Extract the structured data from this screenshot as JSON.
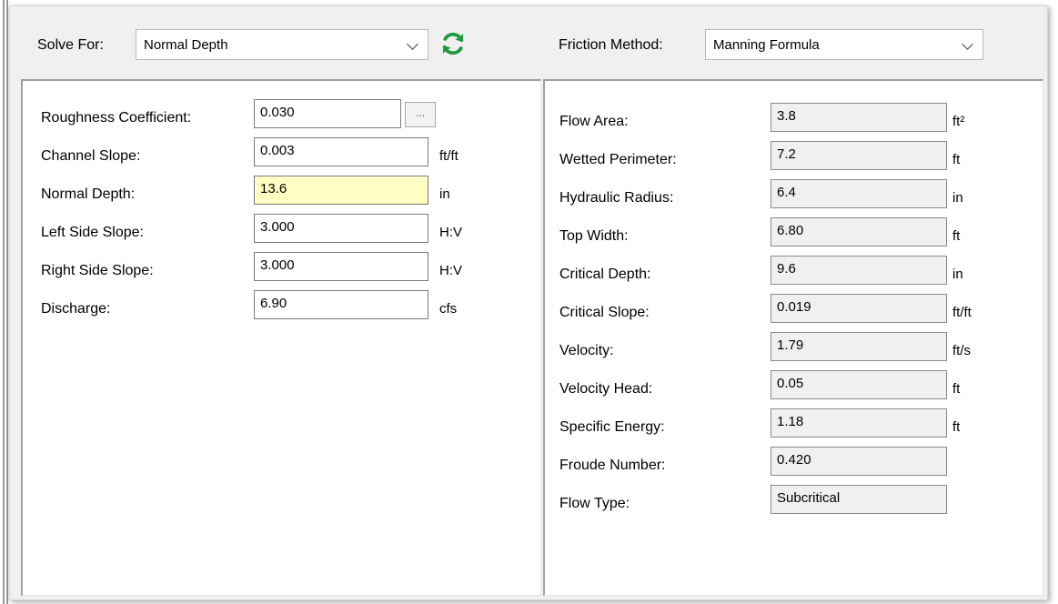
{
  "toolbar": {
    "solve_for_label": "Solve For:",
    "solve_for_value": "Normal Depth",
    "friction_method_label": "Friction Method:",
    "friction_method_value": "Manning Formula"
  },
  "inputs": [
    {
      "label": "Roughness Coefficient:",
      "value": "0.030",
      "unit": ""
    },
    {
      "label": "Channel Slope:",
      "value": "0.003",
      "unit": "ft/ft"
    },
    {
      "label": "Normal Depth:",
      "value": "13.6",
      "unit": "in"
    },
    {
      "label": "Left Side Slope:",
      "value": "3.000",
      "unit": "H:V"
    },
    {
      "label": "Right Side Slope:",
      "value": "3.000",
      "unit": "H:V"
    },
    {
      "label": "Discharge:",
      "value": "6.90",
      "unit": "cfs"
    }
  ],
  "results": [
    {
      "label": "Flow Area:",
      "value": "3.8",
      "unit": "ft²"
    },
    {
      "label": "Wetted Perimeter:",
      "value": "7.2",
      "unit": "ft"
    },
    {
      "label": "Hydraulic Radius:",
      "value": "6.4",
      "unit": "in"
    },
    {
      "label": "Top Width:",
      "value": "6.80",
      "unit": "ft"
    },
    {
      "label": "Critical Depth:",
      "value": "9.6",
      "unit": "in"
    },
    {
      "label": "Critical Slope:",
      "value": "0.019",
      "unit": "ft/ft"
    },
    {
      "label": "Velocity:",
      "value": "1.79",
      "unit": "ft/s"
    },
    {
      "label": "Velocity Head:",
      "value": "0.05",
      "unit": "ft"
    },
    {
      "label": "Specific Energy:",
      "value": "1.18",
      "unit": "ft"
    },
    {
      "label": "Froude Number:",
      "value": "0.420",
      "unit": ""
    },
    {
      "label": "Flow Type:",
      "value": "Subcritical",
      "unit": ""
    }
  ],
  "ellipsis_label": "...",
  "icons": {
    "refresh": "refresh-icon",
    "dropdown": "chevron-down-icon"
  },
  "colors": {
    "highlight_field": "#ffffc4",
    "refresh_icon": "#1f9a3c",
    "panel_bg": "#ffffff",
    "window_bg": "#f0f0f0"
  }
}
